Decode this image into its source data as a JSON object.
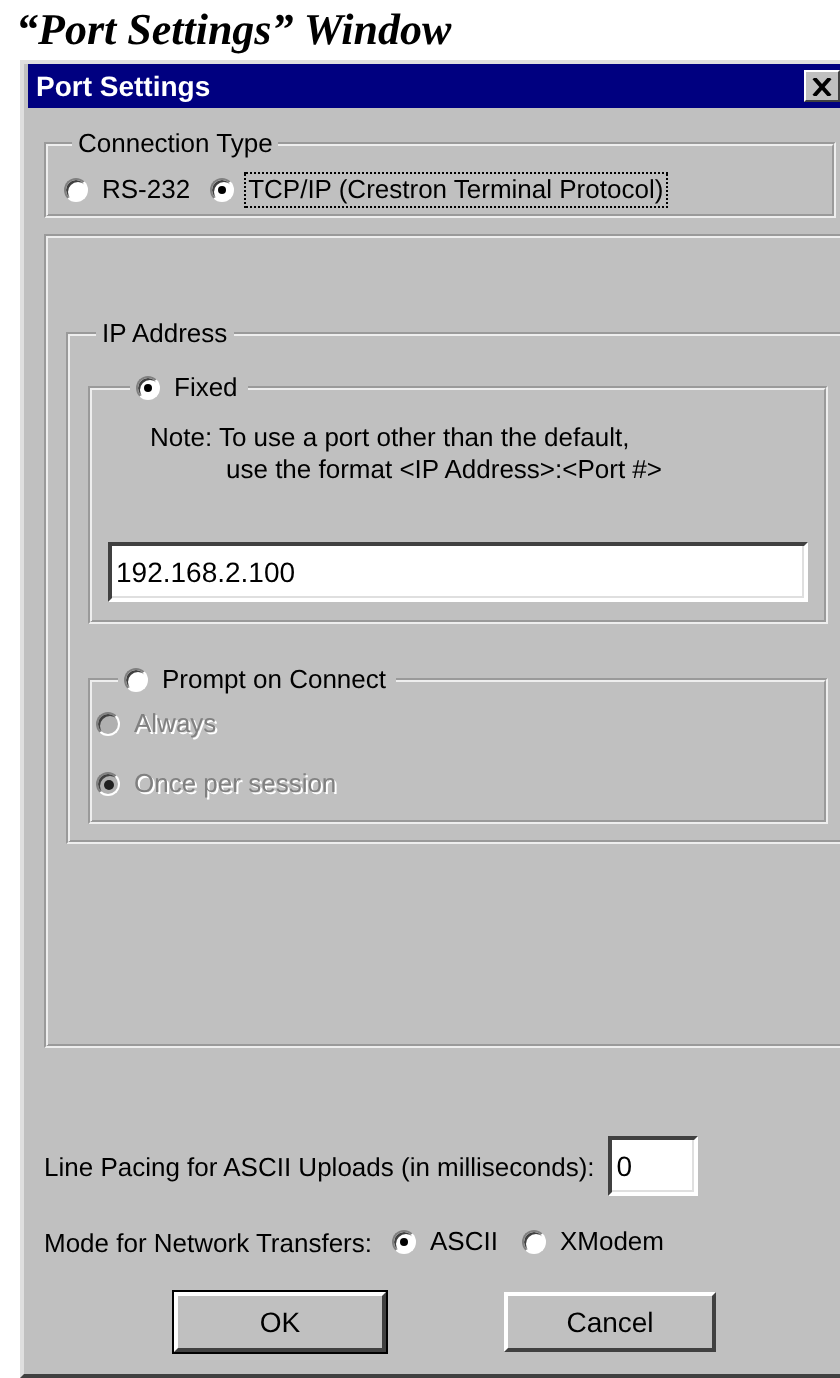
{
  "caption": "“Port Settings” Window",
  "window": {
    "title": "Port Settings"
  },
  "connection_type": {
    "label": "Connection Type",
    "options": [
      {
        "label": "RS-232",
        "selected": false,
        "focused": false
      },
      {
        "label": "TCP/IP (Crestron Terminal Protocol)",
        "selected": true,
        "focused": true
      }
    ]
  },
  "ip_address": {
    "label": "IP Address",
    "fixed": {
      "label": "Fixed",
      "selected": true,
      "note_lines": [
        "Note: To use a port other than the default,",
        "use the format <IP Address>:<Port #>"
      ],
      "value": "192.168.2.100"
    },
    "prompt": {
      "label": "Prompt on Connect",
      "selected": false,
      "options": [
        {
          "label": "Always",
          "selected": false,
          "disabled": true
        },
        {
          "label": "Once per session",
          "selected": true,
          "disabled": true
        }
      ]
    }
  },
  "line_pacing": {
    "label": "Line Pacing for ASCII Uploads (in milliseconds):",
    "value": "0"
  },
  "transfer_mode": {
    "label": "Mode for Network Transfers:",
    "options": [
      {
        "label": "ASCII",
        "selected": true
      },
      {
        "label": "XModem",
        "selected": false
      }
    ]
  },
  "buttons": [
    {
      "label": "OK",
      "default": true
    },
    {
      "label": "Cancel",
      "default": false
    }
  ]
}
